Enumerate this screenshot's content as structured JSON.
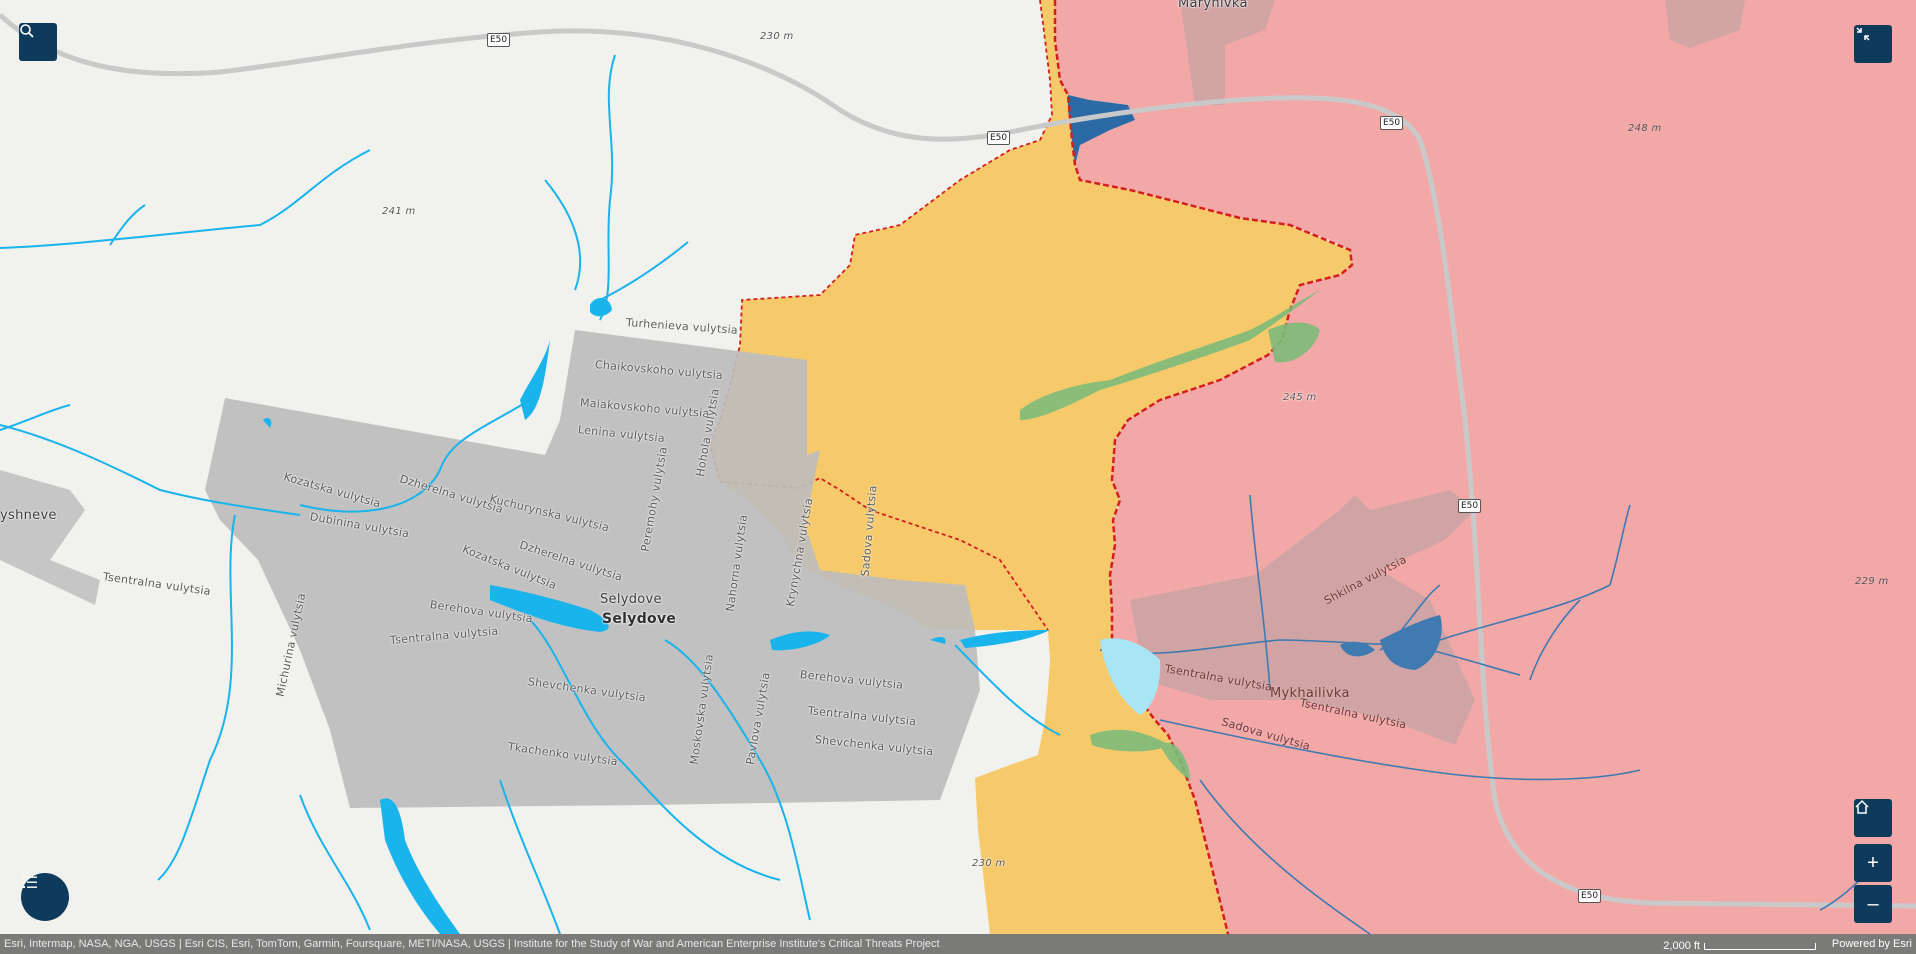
{
  "colors": {
    "background": "#f1f1ee",
    "russian_controlled": "#f3a8a8",
    "russian_advance": "#f6c96b",
    "contested": "#2c6aa6",
    "urban": "#bdbdbd",
    "water": "#19b4ec",
    "frontline": "#d41f1f",
    "button": "#0e3a5c"
  },
  "controls": {
    "search": "search-icon",
    "collapse": "collapse-icon",
    "legend": "legend-list-icon",
    "home": "home-icon",
    "zoom_in": "+",
    "zoom_out": "–"
  },
  "roads": {
    "shield_label": "E50"
  },
  "labels": {
    "place_marynivka": "Marynivka",
    "place_vyshneve": "yshneve",
    "place_selydove_small": "Selydove",
    "place_selydove": "Selydove",
    "place_mykhailivka": "Mykhailivka",
    "turhenieva": "Turhenieva vulytsia",
    "chaikovskoho": "Chaikovskoho vulytsia",
    "maiakovskoho": "Maiakovskoho vulytsia",
    "lenina": "Lenina vulytsia",
    "kozatska1": "Kozatska vulytsia",
    "dzherelna1": "Dzherelna vulytsia",
    "kuchurynska": "Kuchurynska vulytsia",
    "peremohy": "Peremohy vulytsia",
    "hohola": "Hohola vulytsia",
    "dubinina": "Dubinina vulytsia",
    "kozatska2": "Kozatska vulytsia",
    "dzherelna2": "Dzherelna vulytsia",
    "tsentralna_w": "Tsentralna vulytsia",
    "tsentralna_c": "Tsentralna vulytsia",
    "berehova_w": "Berehova vulytsia",
    "michurina": "Michurina vulytsia",
    "nahorna": "Nahorna vulytsia",
    "krynychna": "Krynychna vulytsia",
    "sadova_mid": "Sadova vulytsia",
    "shevchenka1": "Shevchenka vulytsia",
    "moskovska": "Moskovska vulytsia",
    "pavlova": "Pavlova vulytsia",
    "berehova_e": "Berehova vulytsia",
    "tsentralna_e": "Tsentralna vulytsia",
    "shevchenka2": "Shevchenka vulytsia",
    "tkachenko": "Tkachenko vulytsia",
    "shkilna": "Shkilna vulytsia",
    "tsentralna_m": "Tsentralna vulytsia",
    "tsentralna_m2": "Tsentralna vulytsia",
    "sadova_m": "Sadova vulytsia",
    "tsentralna_far": "Tsentralna vulytsia"
  },
  "elevations": {
    "e1": "230 m",
    "e2": "241 m",
    "e3": "248 m",
    "e4": "245 m",
    "e5": "229 m",
    "e6": "230 m"
  },
  "attribution": "Esri, Intermap, NASA, NGA, USGS | Esri CIS, Esri, TomTom, Garmin, Foursquare, METI/NASA, USGS | Institute for the Study of War and American Enterprise Institute's Critical Threats Project",
  "scale": "2,000 ft",
  "powered_by": "Powered by Esri"
}
